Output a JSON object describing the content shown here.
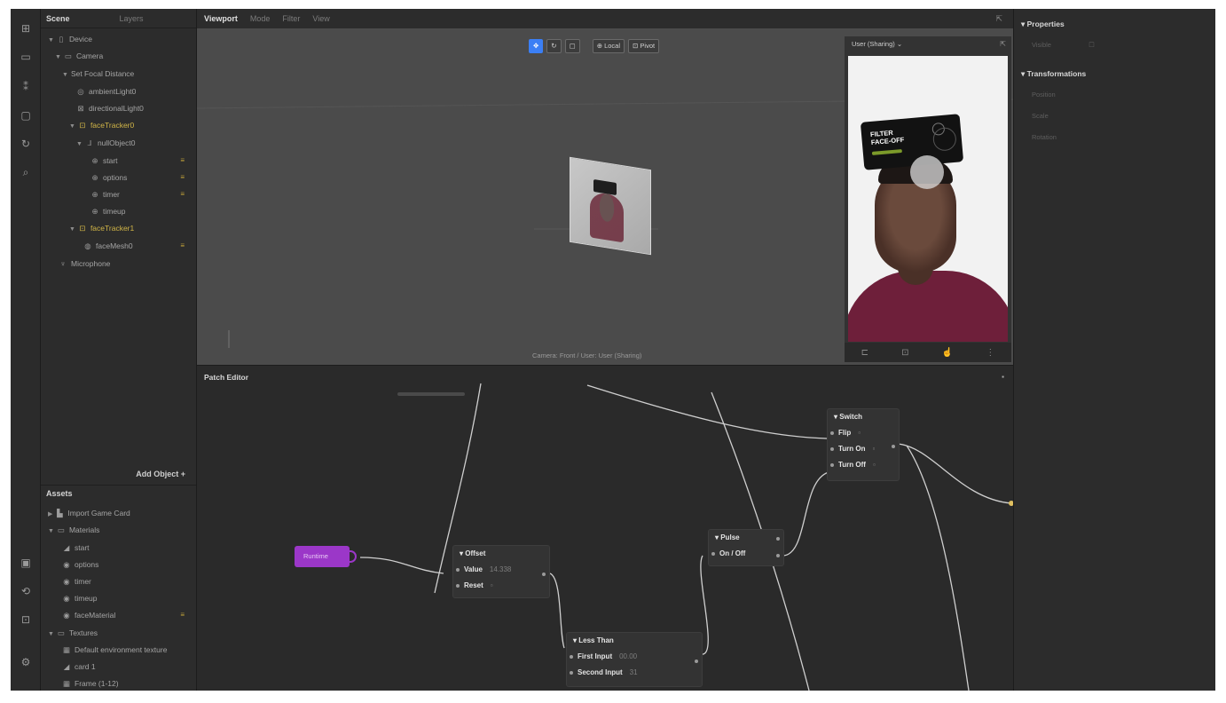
{
  "scene_tabs": [
    "Scene",
    "Layers"
  ],
  "scene_tree": [
    {
      "label": "Device"
    },
    {
      "label": "Camera"
    },
    {
      "label": "Set Focal Distance"
    },
    {
      "label": "ambientLight0"
    },
    {
      "label": "directionalLight0"
    },
    {
      "label": "faceTracker0"
    },
    {
      "label": "nullObject0"
    },
    {
      "label": "start"
    },
    {
      "label": "options"
    },
    {
      "label": "timer"
    },
    {
      "label": "timeup"
    },
    {
      "label": "faceTracker1"
    },
    {
      "label": "faceMesh0"
    },
    {
      "label": "Microphone"
    }
  ],
  "add_object_label": "Add Object",
  "assets_title": "Assets",
  "assets_tree": [
    {
      "label": "Import Game Card"
    },
    {
      "label": "Materials"
    },
    {
      "label": "start"
    },
    {
      "label": "options"
    },
    {
      "label": "timer"
    },
    {
      "label": "timeup"
    },
    {
      "label": "faceMaterial"
    },
    {
      "label": "Textures"
    },
    {
      "label": "Default environment texture"
    },
    {
      "label": "card 1"
    },
    {
      "label": "Frame (1-12)"
    }
  ],
  "viewport_tabs": [
    "Viewport",
    "Mode",
    "Filter",
    "View"
  ],
  "toolbar": {
    "local_label": "Local",
    "pivot_label": "Pivot"
  },
  "viewport_caption": "Camera: Front / User: User (Sharing)",
  "preview": {
    "selector": "User (Sharing)",
    "card_title_line1": "FILTER",
    "card_title_line2": "FACE-OFF"
  },
  "patch_editor": {
    "title": "Patch Editor",
    "purple_node": "Runtime",
    "offset": {
      "title": "Offset",
      "value_label": "Value",
      "value": "14.338",
      "reset_label": "Reset"
    },
    "less_than": {
      "title": "Less Than",
      "first_label": "First Input",
      "first_value": "00.00",
      "second_label": "Second Input",
      "second_value": "31"
    },
    "pulse": {
      "title": "Pulse",
      "port_label": "On / Off"
    },
    "switch": {
      "title": "Switch",
      "ports": [
        "Flip",
        "Turn On",
        "Turn Off"
      ]
    }
  },
  "properties": {
    "title": "Properties",
    "visible_label": "Visible",
    "transform_title": "Transformations",
    "rows": [
      "Position",
      "Scale",
      "Rotation"
    ]
  },
  "colors": {
    "accent": "#3b7ff5",
    "tracker_yellow": "#d1b547",
    "runtime_purple": "#9b37c8"
  }
}
